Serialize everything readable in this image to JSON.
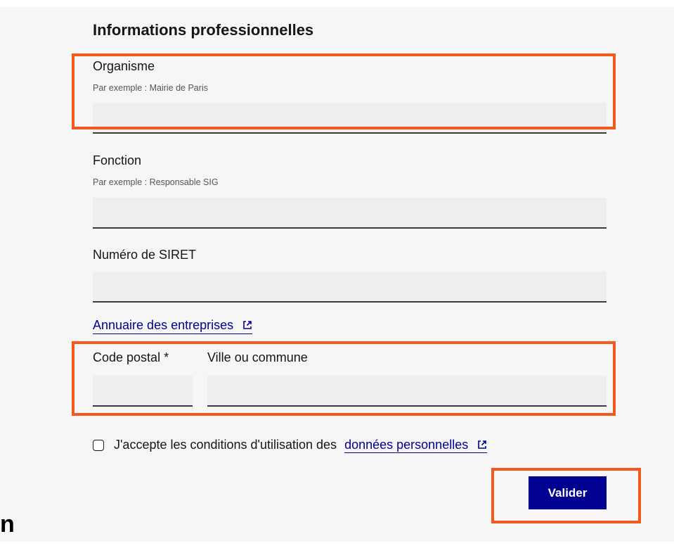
{
  "section": {
    "title": "Informations professionnelles"
  },
  "organisme": {
    "label": "Organisme",
    "hint": "Par exemple : Mairie de Paris",
    "value": ""
  },
  "fonction": {
    "label": "Fonction",
    "hint": "Par exemple : Responsable SIG",
    "value": ""
  },
  "siret": {
    "label": "Numéro de SIRET",
    "value": ""
  },
  "annuaire_link": {
    "label": "Annuaire des entreprises",
    "icon": "external-link-icon"
  },
  "code_postal": {
    "label": "Code postal *",
    "value": ""
  },
  "ville": {
    "label": "Ville ou commune",
    "value": ""
  },
  "consent": {
    "text": "J'accepte les conditions d'utilisation des",
    "link_label": "données personnelles",
    "checked": false,
    "icon": "external-link-icon"
  },
  "submit": {
    "label": "Valider"
  },
  "partial_glyph": "n",
  "colors": {
    "primary": "#000091",
    "annotation": "#f25a1d",
    "input_bg": "#eeeeee",
    "panel_bg": "#f6f6f6"
  }
}
